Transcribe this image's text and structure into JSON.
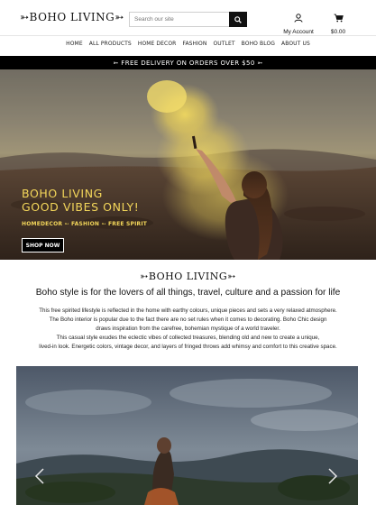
{
  "header": {
    "logo_text": "➳BOHO LIVING➳",
    "search_placeholder": "Search our site",
    "account_label": "My Account",
    "cart_total": "$0.00"
  },
  "nav": {
    "items": [
      {
        "label": "HOME"
      },
      {
        "label": "ALL PRODUCTS"
      },
      {
        "label": "HOME DECOR"
      },
      {
        "label": "FASHION"
      },
      {
        "label": "OUTLET"
      },
      {
        "label": "BOHO BLOG"
      },
      {
        "label": "ABOUT US"
      }
    ]
  },
  "promo": {
    "text": "➳ FREE DELIVERY ON ORDERS OVER $50 ➳"
  },
  "hero": {
    "title_line1": "BOHO LIVING",
    "title_line2": "GOOD VIBES ONLY!",
    "subtitle": "HOMEDECOR ➳ FASHION ➳ FREE SPIRIT",
    "button_label": "SHOP NOW"
  },
  "about": {
    "logo_text": "➳BOHO LIVING➳",
    "heading": "Boho style is for the lovers of all things, travel, culture and a passion for life",
    "lines": [
      "This free spirited lifestyle is reflected in the home with earthy colours, unique pieces and sets a very relaxed atmosphere.",
      "The Boho interior is popular due to the fact there are no set rules when it comes to decorating. Boho Chic design",
      "draws inspiration from the carefree, bohemian mystique of a world traveler.",
      "This casual style exudes the eclectic vibes of collected treasures, blending old and new to create a unique,",
      "lived-in look. Energetic colors, vintage decor, and layers of fringed throws add whimsy and comfort to this creative space."
    ]
  },
  "colors": {
    "accent_yellow": "#f3d65a",
    "promo_bg": "#000000"
  },
  "icons": {
    "search": "search-icon",
    "account": "user-icon",
    "cart": "cart-icon",
    "carousel_prev": "chevron-left-icon",
    "carousel_next": "chevron-right-icon"
  }
}
